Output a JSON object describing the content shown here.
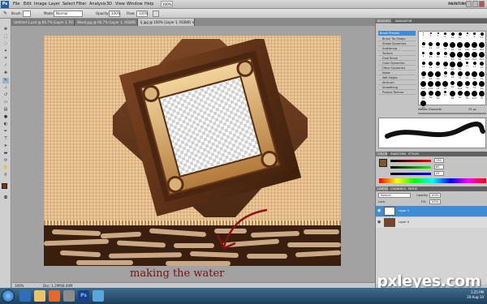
{
  "menubar": {
    "logo": "Ps",
    "items": [
      "File",
      "Edit",
      "Image",
      "Layer",
      "Select",
      "Filter",
      "Analysis",
      "3D",
      "View",
      "Window",
      "Help"
    ],
    "zoom": "100%",
    "workspace": "PAINTING ▾"
  },
  "options": {
    "brush_label": "Brush:",
    "mode_label": "Mode:",
    "mode_value": "Normal",
    "opacity_label": "Opacity:",
    "opacity_value": "100%",
    "flow_label": "Flow:",
    "flow_value": "100%"
  },
  "tabs": [
    "Untitled-1.psd @ 66.7% (Layer 3, RGB/8) ×",
    "Wood.jpg @ 66.7% (Layer 1, RGB/8) ×",
    "Ij.jpg @ 100% (Layer 1, RGB/8) ×"
  ],
  "status": {
    "zoom": "100%",
    "doc": "Doc: 1.29M/8.49M"
  },
  "caption": "making the water",
  "watermark": "pxleyes.com",
  "panels": {
    "brushes_tabs": [
      "BRUSHES",
      "NAVIGATOR"
    ],
    "brush_presets_label": "Brush Presets",
    "brush_options": [
      "Brush Tip Shape",
      "Shape Dynamics",
      "Scattering",
      "Texture",
      "Dual Brush",
      "Color Dynamics",
      "Other Dynamics",
      "Noise",
      "Wet Edges",
      "Airbrush",
      "Smoothing",
      "Protect Texture"
    ],
    "brush_sizes": [
      "1",
      "3",
      "5",
      "9",
      "13",
      "19",
      "5",
      "9",
      "13",
      "17",
      "21",
      "27",
      "35",
      "45",
      "65",
      "100",
      "200",
      "300",
      "9",
      "13",
      "19",
      "17",
      "45",
      "65",
      "100",
      "200",
      "300",
      "14",
      "24",
      "27",
      "39",
      "46",
      "59",
      "11",
      "17",
      "23",
      "36",
      "44",
      "60",
      "14",
      "26",
      "33",
      "42",
      "55",
      "70",
      "112",
      "134",
      "74",
      "95",
      "29",
      "192",
      "36",
      "33",
      "63",
      "66",
      "39",
      "63",
      "11",
      "48",
      "32",
      "55",
      "100",
      "75",
      "45"
    ],
    "master_diameter_label": "Master Diameter",
    "master_diameter_value": "35 px",
    "color_tabs": [
      "COLOR",
      "SWATCHES",
      "STYLES"
    ],
    "color_values": {
      "r": "130",
      "g": "85",
      "b": "47"
    },
    "layers_tabs": [
      "LAYERS",
      "CHANNELS",
      "PATHS"
    ],
    "blend_mode": "Normal",
    "opacity_label": "Opacity:",
    "opacity_value": "100%",
    "lock_label": "Lock:",
    "fill_label": "Fill:",
    "fill_value": "100%",
    "layers": [
      {
        "name": "Layer 1",
        "selected": true
      },
      {
        "name": "Layer 0",
        "selected": false
      }
    ]
  },
  "taskbar": {
    "time": "1:25 PM",
    "date": "20-Aug-10"
  },
  "colors": {
    "accent_selected_layer": "#3c8cd8",
    "caption_color": "#7a1010",
    "water_dark": "#3a1e0e",
    "fabric": "#e8c08e",
    "frame_wood": "#6b3a1a"
  }
}
